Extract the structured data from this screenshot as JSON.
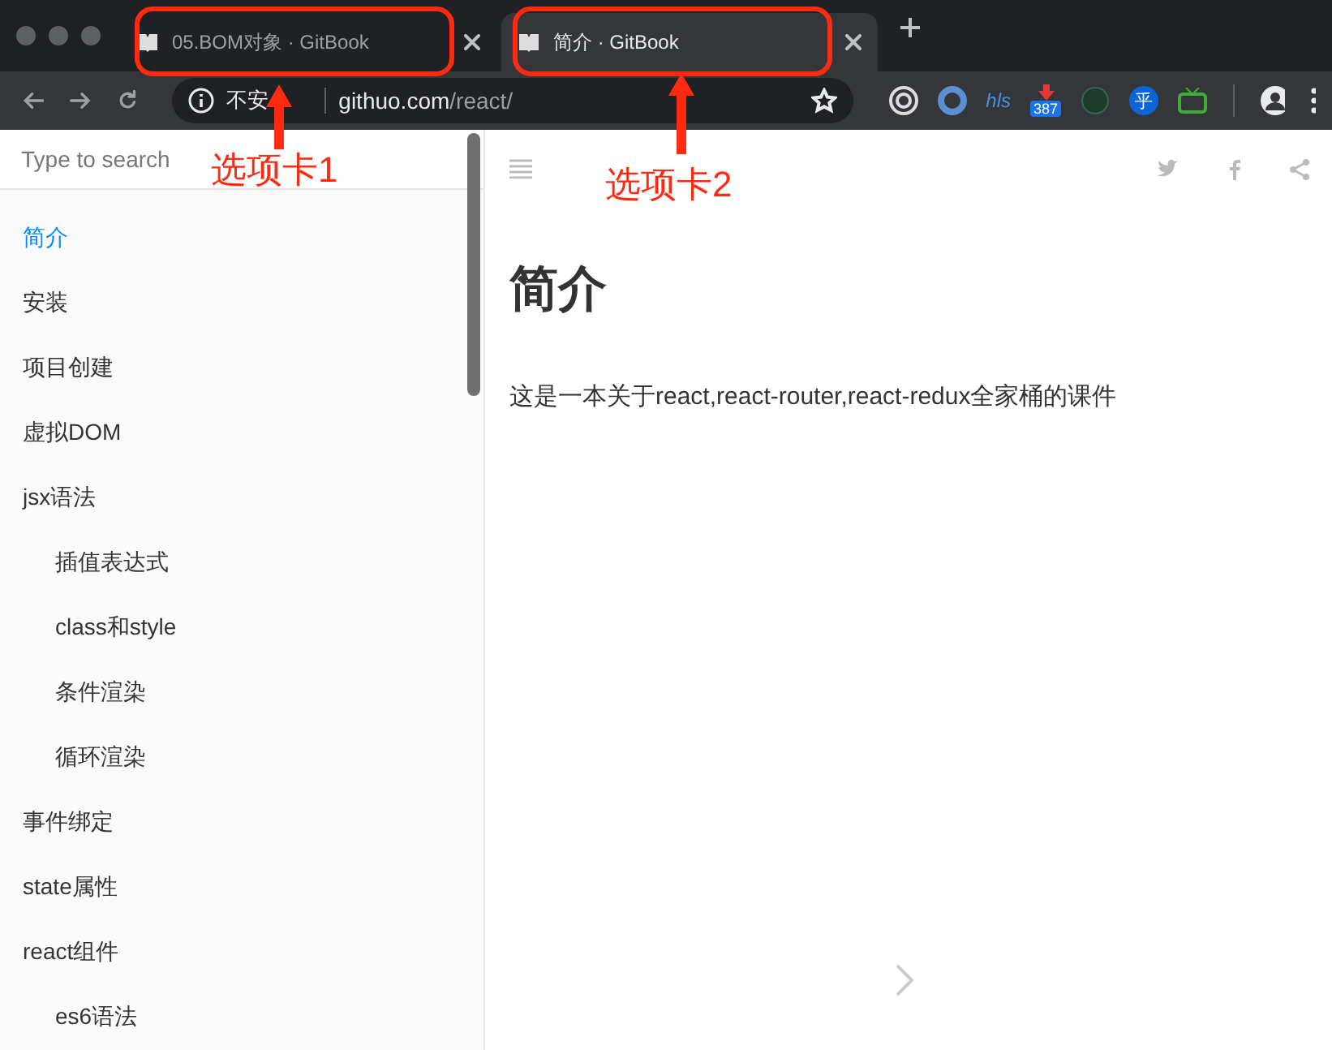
{
  "tabs": [
    {
      "title": "05.BOM对象 · GitBook",
      "selected": false
    },
    {
      "title": "简介 · GitBook",
      "selected": true
    }
  ],
  "address": {
    "security": "不安",
    "host": "githuo.com",
    "path": "/react/"
  },
  "extensions": [
    {
      "kind": "target"
    },
    {
      "kind": "ring"
    },
    {
      "kind": "hls",
      "text": "hls"
    },
    {
      "kind": "download",
      "badge": "387"
    },
    {
      "kind": "leaf"
    },
    {
      "kind": "zhi",
      "text": "乎"
    },
    {
      "kind": "tv"
    }
  ],
  "sidebar": {
    "search": {
      "placeholder": "Type to search"
    },
    "items": [
      {
        "label": "简介",
        "selected": true
      },
      {
        "label": "安装",
        "selected": false
      },
      {
        "label": "项目创建",
        "selected": false
      },
      {
        "label": "虚拟DOM",
        "selected": false
      },
      {
        "label": "jsx语法",
        "selected": false,
        "children": [
          {
            "label": "插值表达式",
            "selected": false
          },
          {
            "label": "class和style",
            "selected": false
          },
          {
            "label": "条件渲染",
            "selected": false
          },
          {
            "label": "循环渲染",
            "selected": false
          }
        ]
      },
      {
        "label": "事件绑定",
        "selected": false
      },
      {
        "label": "state属性",
        "selected": false
      },
      {
        "label": "react组件",
        "selected": false,
        "children": [
          {
            "label": "es6语法",
            "selected": false
          }
        ]
      }
    ]
  },
  "page": {
    "title": "简介",
    "body": "这是一本关于react,react-router,react-redux全家桶的课件"
  },
  "annotations": [
    {
      "label": "选项卡1"
    },
    {
      "label": "选项卡2"
    }
  ]
}
